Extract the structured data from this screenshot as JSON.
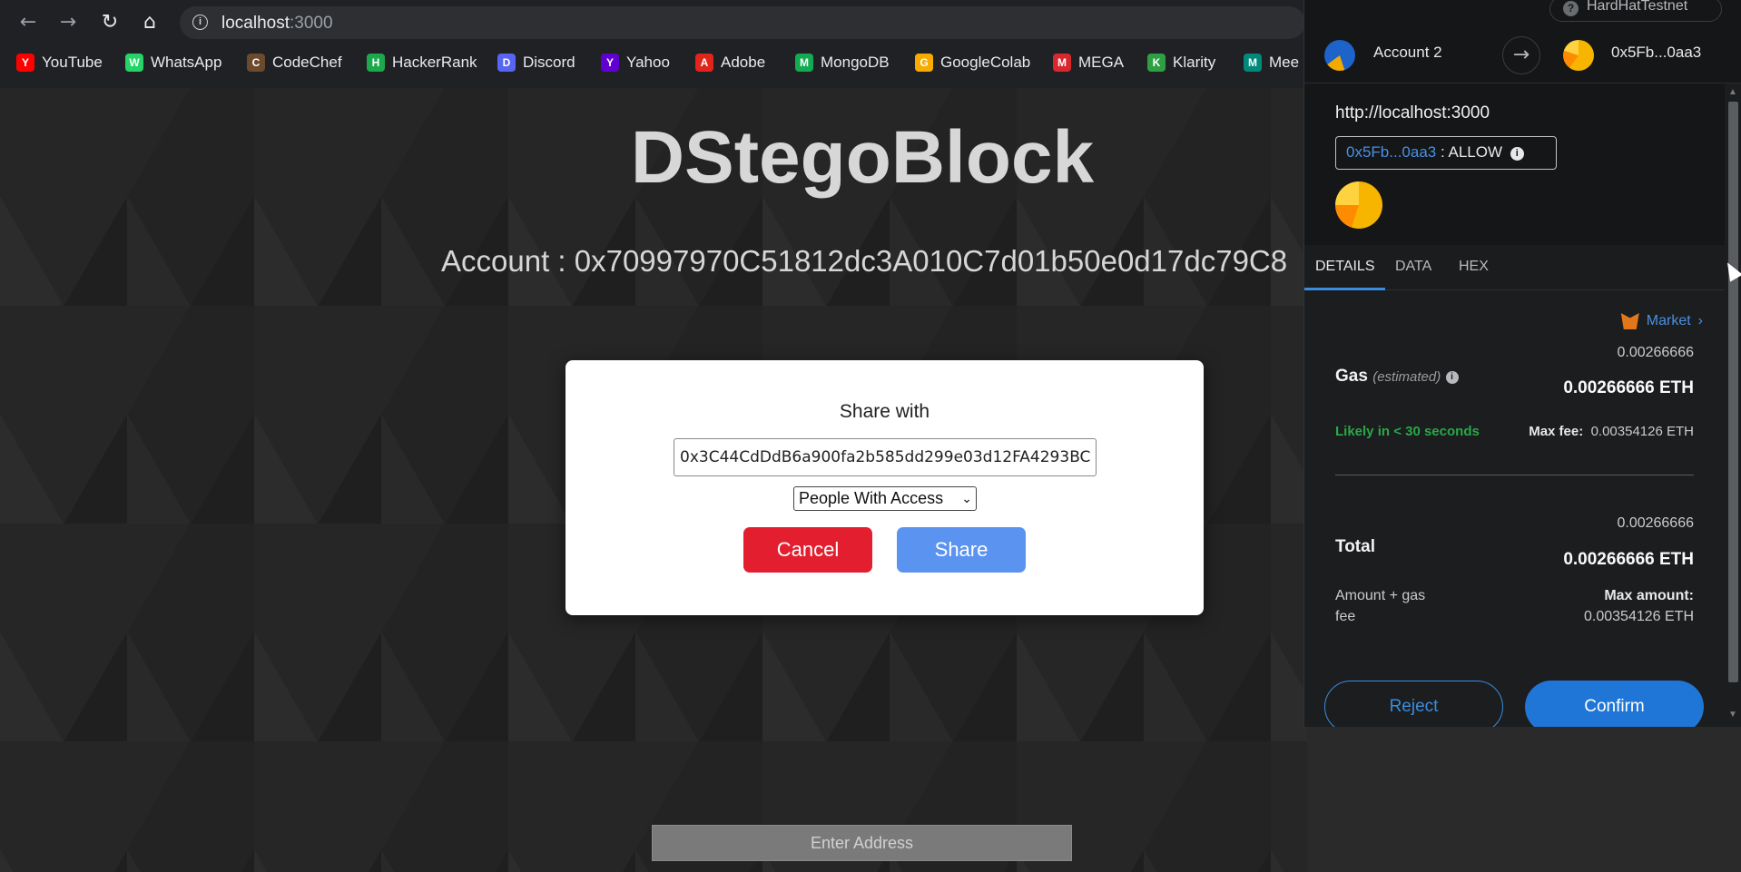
{
  "browser": {
    "url_host": "localhost",
    "url_port": ":3000",
    "bookmarks": [
      {
        "label": "YouTube",
        "color": "#ff0000",
        "icon": "youtube-icon"
      },
      {
        "label": "WhatsApp",
        "color": "#25d366",
        "icon": "whatsapp-icon"
      },
      {
        "label": "CodeChef",
        "color": "#6b4a2e",
        "icon": "codechef-icon"
      },
      {
        "label": "HackerRank",
        "color": "#1ba94c",
        "icon": "hackerrank-icon"
      },
      {
        "label": "Discord",
        "color": "#5865f2",
        "icon": "discord-icon"
      },
      {
        "label": "Yahoo",
        "color": "#6001d2",
        "icon": "yahoo-icon"
      },
      {
        "label": "Adobe",
        "color": "#e1251b",
        "icon": "adobe-icon"
      },
      {
        "label": "MongoDB",
        "color": "#13aa52",
        "icon": "mongodb-icon"
      },
      {
        "label": "GoogleColab",
        "color": "#f9ab00",
        "icon": "colab-icon"
      },
      {
        "label": "MEGA",
        "color": "#d9272e",
        "icon": "mega-icon"
      },
      {
        "label": "Klarity",
        "color": "#2ea043",
        "icon": "klarity-icon"
      },
      {
        "label": "Mee",
        "color": "#00897b",
        "icon": "meet-icon"
      }
    ]
  },
  "app": {
    "title": "DStegoBlock",
    "account_label": "Account : 0x70997970C51812dc3A010C7d01b50e0d17dc79C8",
    "enter_address_placeholder": "Enter Address"
  },
  "modal": {
    "title": "Share with",
    "input_value": "0x3C44CdDdB6a900fa2b585dd299e03d12FA4293BC",
    "select_value": "People With Access",
    "cancel_label": "Cancel",
    "share_label": "Share"
  },
  "metamask": {
    "network": "HardHatTestnet",
    "from_account": "Account 2",
    "to_account": "0x5Fb...0aa3",
    "origin": "http://localhost:3000",
    "allow_address": "0x5Fb...0aa3",
    "allow_text": ": ALLOW",
    "tabs": [
      "DETAILS",
      "DATA",
      "HEX"
    ],
    "market_label": "Market",
    "gas_label": "Gas",
    "gas_estimated": "(estimated)",
    "gas_value": "0.00266666",
    "gas_value_eth": "0.00266666 ETH",
    "likely": "Likely in < 30 seconds",
    "max_fee_label": "Max fee:",
    "max_fee_value": "0.00354126 ETH",
    "total_label": "Total",
    "total_value": "0.00266666",
    "total_value_eth": "0.00266666 ETH",
    "amount_gas_fee": "Amount + gas fee",
    "max_amount_label": "Max amount:",
    "max_amount_value": "0.00354126 ETH",
    "reject_label": "Reject",
    "confirm_label": "Confirm"
  }
}
